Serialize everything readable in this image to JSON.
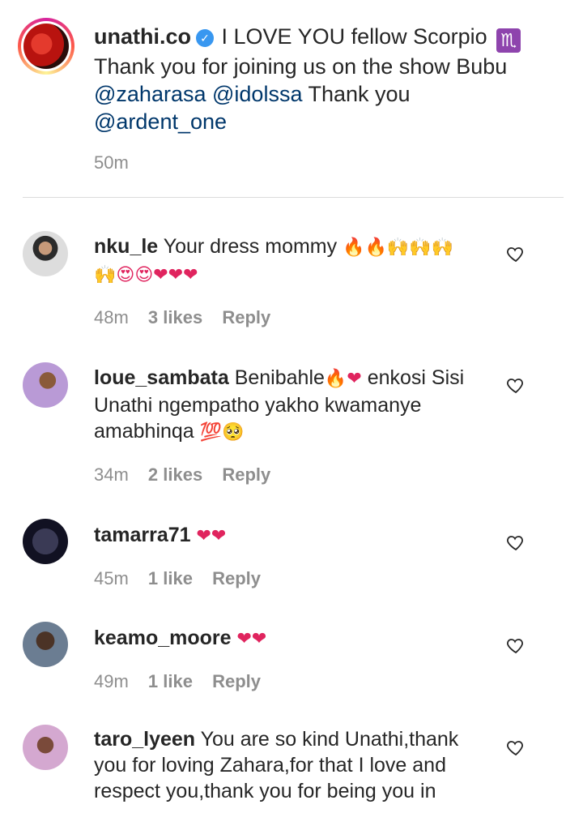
{
  "post": {
    "username": "unathi.co",
    "verified_badge": "verified-badge-icon",
    "caption_lines": {
      "line1": "I LOVE YOU fellow Scorpio",
      "zodiac_symbol": "♏",
      "line2": "Thank you for joining us on the show Bubu",
      "mention1": "@zaharasa",
      "mention2": "@idolssa",
      "after_mentions": "Thank you",
      "mention3": "@ardent_one"
    },
    "time": "50m"
  },
  "comments": [
    {
      "username": "nku_le",
      "text": "Your dress mommy",
      "emoji_line1": "🔥🔥🙌🙌🙌",
      "emoji_line2": "🙌😍😍❤❤❤",
      "time": "48m",
      "likes": "3 likes",
      "reply": "Reply"
    },
    {
      "username": "loue_sambata",
      "text_a": "Benibahle",
      "emoji_a": "🔥❤",
      "text_b": "enkosi Sisi Unathi ngempatho yakho kwamanye amabhinqa",
      "emoji_b": "💯🥺",
      "time": "34m",
      "likes": "2 likes",
      "reply": "Reply"
    },
    {
      "username": "tamarra71",
      "emoji": "❤❤",
      "time": "45m",
      "likes": "1 like",
      "reply": "Reply"
    },
    {
      "username": "keamo_moore",
      "emoji": "❤❤",
      "time": "49m",
      "likes": "1 like",
      "reply": "Reply"
    },
    {
      "username": "taro_lyeen",
      "text": "You are so kind Unathi,thank you for loving Zahara,for that I love and respect you,thank you for being you in"
    }
  ],
  "icons": {
    "like": "heart-outline-icon"
  },
  "colors": {
    "mention": "#00376b",
    "muted": "#8e8e8e",
    "verified": "#3897f0"
  }
}
